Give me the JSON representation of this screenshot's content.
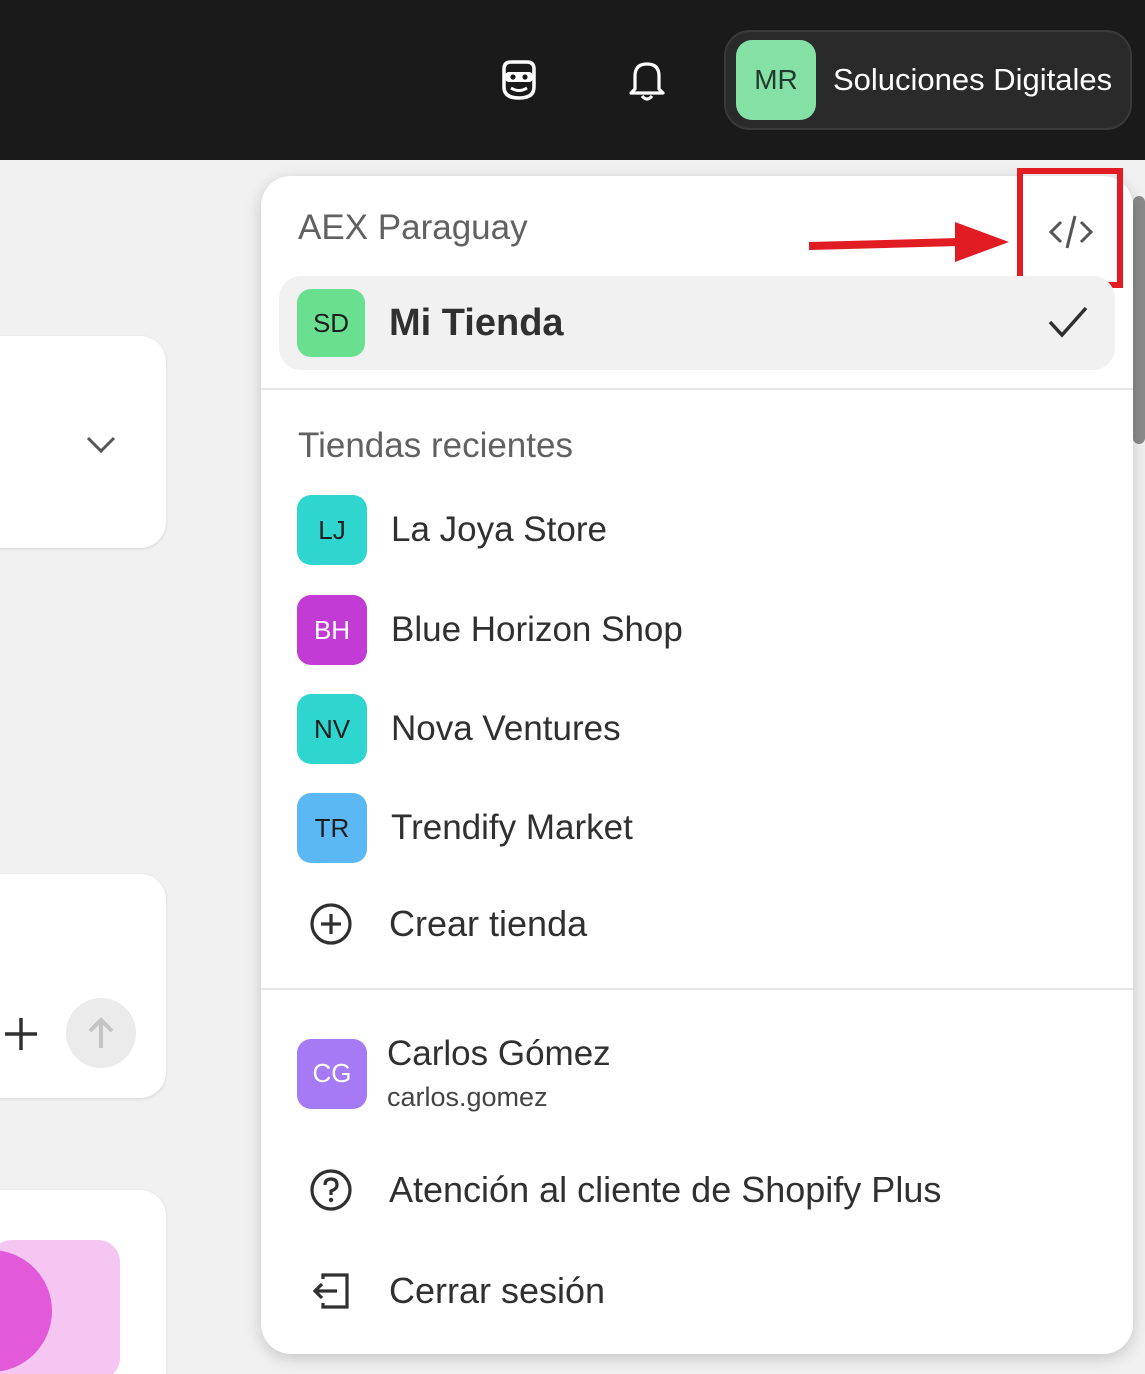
{
  "topbar": {
    "account": {
      "initials": "MR",
      "name": "Soluciones Digitales",
      "avatar_color": "#84e0a4"
    }
  },
  "dropdown": {
    "org_name": "AEX Paraguay",
    "current_store": {
      "initials": "SD",
      "name": "Mi Tienda",
      "avatar_color": "#69e08f"
    },
    "recent_label": "Tiendas recientes",
    "recent_stores": [
      {
        "initials": "LJ",
        "name": "La Joya Store",
        "avatar_color": "#2fd6cf"
      },
      {
        "initials": "BH",
        "name": "Blue Horizon Shop",
        "avatar_color": "#c23bd4"
      },
      {
        "initials": "NV",
        "name": "Nova Ventures",
        "avatar_color": "#2fd6cf"
      },
      {
        "initials": "TR",
        "name": "Trendify Market",
        "avatar_color": "#5cb8f5"
      }
    ],
    "create_store_label": "Crear tienda",
    "user": {
      "initials": "CG",
      "name": "Carlos Gómez",
      "handle": "carlos.gomez",
      "avatar_color": "#a77af5"
    },
    "support_label": "Atención al cliente de Shopify Plus",
    "logout_label": "Cerrar sesión"
  },
  "annotation": {
    "highlight_color": "#e11d23"
  },
  "icons": [
    "assistant-icon",
    "bell-icon",
    "code-icon",
    "checkmark-icon",
    "plus-circle-icon",
    "question-circle-icon",
    "logout-icon",
    "chevron-down-icon",
    "plus-icon",
    "arrow-up-icon"
  ]
}
